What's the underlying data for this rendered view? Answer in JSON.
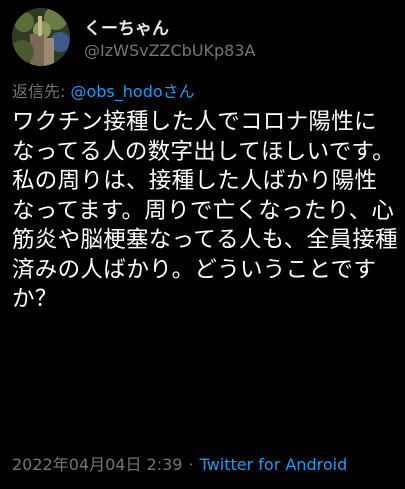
{
  "user": {
    "display_name": "くーちゃん",
    "handle": "@IzWSvZZCbUKp83A"
  },
  "reply": {
    "prefix": "返信先: ",
    "mention": "@obs_hodoさん"
  },
  "tweet": {
    "text": "ワクチン接種した人でコロナ陽性になってる人の数字出してほしいです。\n私の周りは、接種した人ばかり陽性なってます。周りで亡くなったり、心筋炎や脳梗塞なってる人も、全員接種済みの人ばかり。どういうことですか？"
  },
  "meta": {
    "timestamp": "2022年04月04日 2:39",
    "separator": "·",
    "source": "Twitter for Android"
  },
  "colors": {
    "background": "#000000",
    "text_primary": "#ffffff",
    "text_secondary": "#71767b",
    "link": "#1d9bf0"
  },
  "icons": {
    "avatar": "profile-photo-avatar"
  }
}
